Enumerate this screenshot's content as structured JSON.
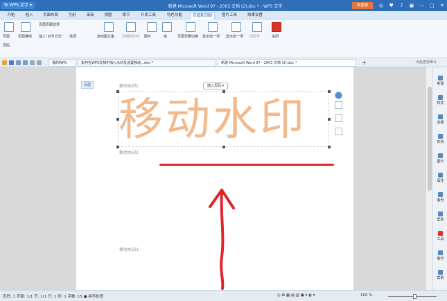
{
  "titlebar": {
    "app_button": "W WPS 文字 ▾",
    "doc_title": "新建 Microsoft Word 97 - 2003 文档 (2).doc * - WPS 文字",
    "login": "未登录",
    "window_controls": [
      "◎",
      "♥",
      "?",
      "▣",
      "—",
      "□",
      "✕"
    ]
  },
  "menu": {
    "tabs": [
      "开始",
      "插入",
      "页面布局",
      "引用",
      "审阅",
      "视图",
      "章节",
      "开发工具",
      "特色功能",
      "页眉和页脚",
      "图片工具",
      "效果设置"
    ],
    "active_index": 9
  },
  "ribbon": {
    "items": [
      {
        "label": "页眉"
      },
      {
        "label": "页眉横线"
      },
      {
        "label": "页眉页脚选项"
      },
      {
        "label": "插入“对齐方式”"
      },
      {
        "label": "页码"
      },
      {
        "label": "选择"
      },
      {
        "label": "自动图文集"
      },
      {
        "label": "日期和时间"
      },
      {
        "label": "图片"
      },
      {
        "label": "域"
      },
      {
        "label": "页眉页脚切换"
      },
      {
        "label": "显示前一项"
      },
      {
        "label": "显示后一项"
      },
      {
        "label": "同前节"
      },
      {
        "label": "关闭"
      }
    ]
  },
  "doctabs": {
    "tabs": [
      {
        "label": "我的WPS",
        "active": false
      },
      {
        "label": "如何在WPS文档中加入水印及设置移动...doc *",
        "active": false
      },
      {
        "label": "新建 Microsoft Word 97 - 2003 文档 (2).doc *",
        "active": true
      }
    ],
    "add": "+",
    "search": "点此查找命令"
  },
  "document": {
    "switch_label": "页眉",
    "insert_page_button": "插入页码 ▾",
    "paragraph_labels": [
      "移动水印1",
      "移动水印2",
      "移动水印3"
    ],
    "watermark_text": "移动水印"
  },
  "right_panel": {
    "items": [
      "新建",
      "样式",
      "选择",
      "形状",
      "图片",
      "属性",
      "备份",
      "帮助",
      "工具",
      "备份",
      "帮助"
    ]
  },
  "status": {
    "left": "页码: 1  页面: 1/1  节: 1/1  行: 1  列: 1  字数: 15  ● 拼写检查",
    "right_icons": "◎ ⊠ ▦ ▤ ▥ ▣ ▾ ◐ ▾",
    "zoom": "100 %",
    "zoom_fraction": 0.5
  },
  "colors": {
    "title_bg": "#2f6fba",
    "watermark": "#f2b98c",
    "annotation_red": "#e0262d"
  }
}
